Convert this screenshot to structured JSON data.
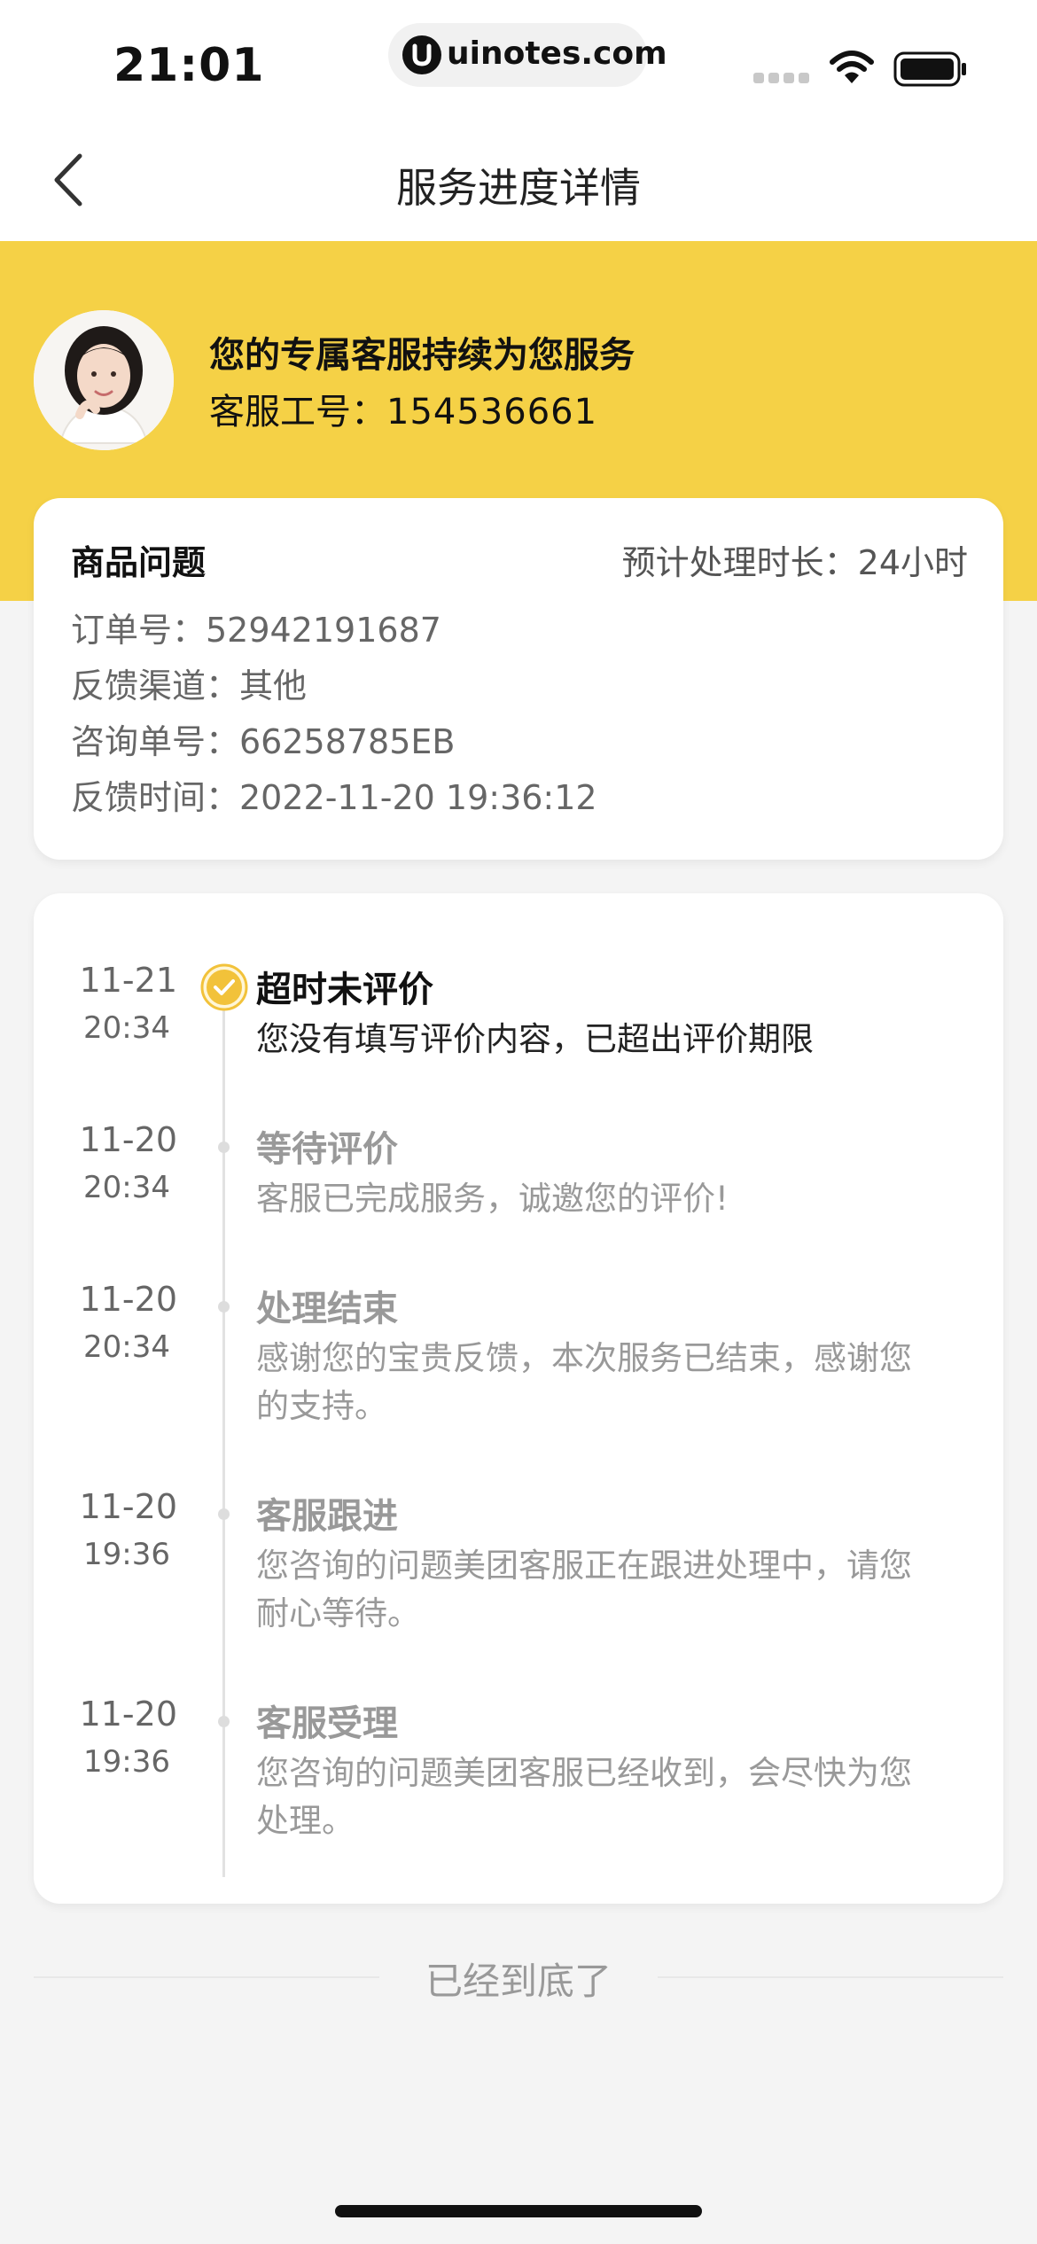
{
  "status_bar": {
    "time": "21:01",
    "url": "uinotes.com"
  },
  "nav": {
    "title": "服务进度详情"
  },
  "agent": {
    "headline": "您的专属客服持续为您服务",
    "id_label": "客服工号：",
    "id_value": "154536661"
  },
  "ticket": {
    "type": "商品问题",
    "estimated_duration": "预计处理时长：24小时",
    "rows": [
      "订单号：52942191687",
      "反馈渠道：其他",
      "咨询单号：66258785EB",
      "反馈时间：2022-11-20 19:36:12"
    ]
  },
  "timeline": [
    {
      "date": "11-21",
      "time": "20:34",
      "title": "超时未评价",
      "desc": "您没有填写评价内容，已超出评价期限",
      "active": true
    },
    {
      "date": "11-20",
      "time": "20:34",
      "title": "等待评价",
      "desc": "客服已完成服务，诚邀您的评价!",
      "active": false
    },
    {
      "date": "11-20",
      "time": "20:34",
      "title": "处理结束",
      "desc": "感谢您的宝贵反馈，本次服务已结束，感谢您的支持。",
      "active": false
    },
    {
      "date": "11-20",
      "time": "19:36",
      "title": "客服跟进",
      "desc": "您咨询的问题美团客服正在跟进处理中，请您耐心等待。",
      "active": false
    },
    {
      "date": "11-20",
      "time": "19:36",
      "title": "客服受理",
      "desc": "您咨询的问题美团客服已经收到，会尽快为您处理。",
      "active": false
    }
  ],
  "footer": {
    "end_text": "已经到底了"
  },
  "colors": {
    "brand_yellow": "#f5d146",
    "active_check": "#f2c23a"
  }
}
